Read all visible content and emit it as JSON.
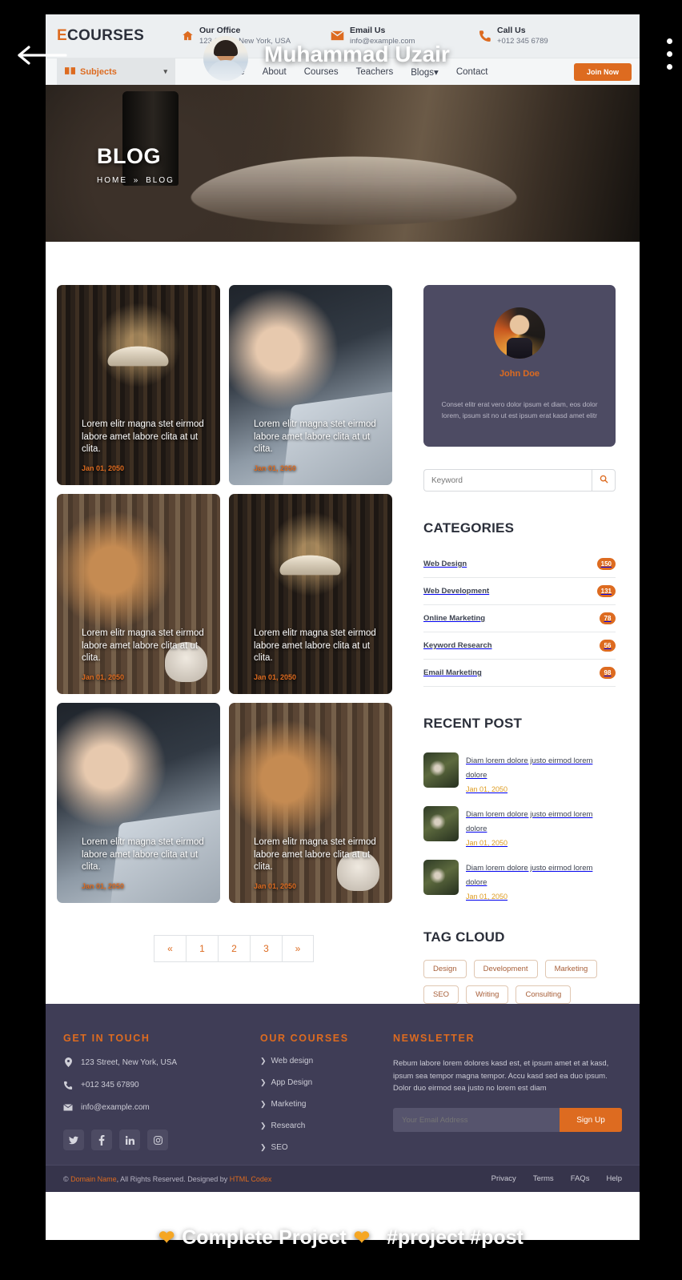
{
  "overlay": {
    "back_icon": "back-arrow-icon",
    "person_name": "Muhammad Uzair",
    "caption_left": "Complete Project",
    "caption_hashtags": "#project #post",
    "heart_icon": "orange-heart-icon"
  },
  "topbar": {
    "brand_first": "E",
    "brand_rest": "COURSES",
    "contacts": [
      {
        "icon": "home-icon",
        "title": "Our Office",
        "value": "123 Street, New York, USA"
      },
      {
        "icon": "email-icon",
        "title": "Email Us",
        "value": "info@example.com"
      },
      {
        "icon": "phone-icon",
        "title": "Call Us",
        "value": "+012 345 6789"
      }
    ]
  },
  "navbar": {
    "subjects_label": "Subjects",
    "subjects_icon": "book-icon",
    "caret_icon": "chevron-down-icon",
    "links": [
      "Home",
      "About",
      "Courses",
      "Teachers",
      "Blogs",
      "Contact"
    ],
    "blogs_caret": "▾",
    "cta_label": "Join Now"
  },
  "hero": {
    "title": "BLOG",
    "crumb_home": "HOME",
    "crumb_sep": "»",
    "crumb_current": "BLOG"
  },
  "posts": [
    {
      "title": "Lorem elitr magna stet eirmod labore amet labore clita at ut clita.",
      "date": "Jan 01, 2050",
      "image": "library-book-photo"
    },
    {
      "title": "Lorem elitr magna stet eirmod labore amet labore clita at ut clita.",
      "date": "Jan 01, 2050",
      "image": "man-laptop-photo"
    },
    {
      "title": "Lorem elitr magna stet eirmod labore amet labore clita at ut clita.",
      "date": "Jan 01, 2050",
      "image": "girl-reading-photo"
    },
    {
      "title": "Lorem elitr magna stet eirmod labore amet labore clita at ut clita.",
      "date": "Jan 01, 2050",
      "image": "library-book-photo"
    },
    {
      "title": "Lorem elitr magna stet eirmod labore amet labore clita at ut clita.",
      "date": "Jan 01, 2050",
      "image": "man-laptop-photo"
    },
    {
      "title": "Lorem elitr magna stet eirmod labore amet labore clita at ut clita.",
      "date": "Jan 01, 2050",
      "image": "girl-reading-photo"
    }
  ],
  "pagination": [
    "«",
    "1",
    "2",
    "3",
    "»"
  ],
  "sidebar": {
    "author": {
      "name": "John Doe",
      "bio": "Conset elitr erat vero dolor ipsum et diam, eos dolor lorem, ipsum sit no ut est ipsum erat kasd amet elitr",
      "avatar": "author-avatar"
    },
    "search": {
      "placeholder": "Keyword",
      "value": "",
      "icon": "search-icon"
    },
    "categories_heading": "CATEGORIES",
    "categories": [
      {
        "label": "Web Design",
        "count": "150"
      },
      {
        "label": "Web Development",
        "count": "131"
      },
      {
        "label": "Online Marketing",
        "count": "78"
      },
      {
        "label": "Keyword Research",
        "count": "56"
      },
      {
        "label": "Email Marketing",
        "count": "98"
      }
    ],
    "recent_heading": "RECENT POST",
    "recent_posts": [
      {
        "title": "Diam lorem dolore justo eirmod lorem dolore",
        "date": "Jan 01, 2050"
      },
      {
        "title": "Diam lorem dolore justo eirmod lorem dolore",
        "date": "Jan 01, 2050"
      },
      {
        "title": "Diam lorem dolore justo eirmod lorem dolore",
        "date": "Jan 01, 2050"
      }
    ],
    "tags_heading": "TAG CLOUD",
    "tags": [
      "Design",
      "Development",
      "Marketing",
      "SEO",
      "Writing",
      "Consulting"
    ]
  },
  "footer": {
    "contact_heading": "GET IN TOUCH",
    "address": "123 Street, New York, USA",
    "phone": "+012 345 67890",
    "email": "info@example.com",
    "socials": [
      "twitter-icon",
      "facebook-icon",
      "linkedin-icon",
      "instagram-icon"
    ],
    "courses_heading": "OUR COURSES",
    "courses": [
      "Web design",
      "App Design",
      "Marketing",
      "Research",
      "SEO"
    ],
    "newsletter_heading": "NEWSLETTER",
    "newsletter_text": "Rebum labore lorem dolores kasd est, et ipsum amet et at kasd, ipsum sea tempor magna tempor. Accu kasd sed ea duo ipsum. Dolor duo eirmod sea justo no lorem est diam",
    "newsletter_placeholder": "Your Email Address",
    "newsletter_button": "Sign Up",
    "copyright_pre": "© ",
    "copyright_brand": "Domain Name",
    "copyright_mid": ", All Rights Reserved. Designed by ",
    "copyright_designer": "HTML Codex",
    "bottom_links": [
      "Privacy",
      "Terms",
      "FAQs",
      "Help"
    ]
  },
  "colors": {
    "accent": "#dd6b20",
    "dark": "#3f3d56",
    "darker": "#36344b",
    "text": "#3c4250"
  }
}
